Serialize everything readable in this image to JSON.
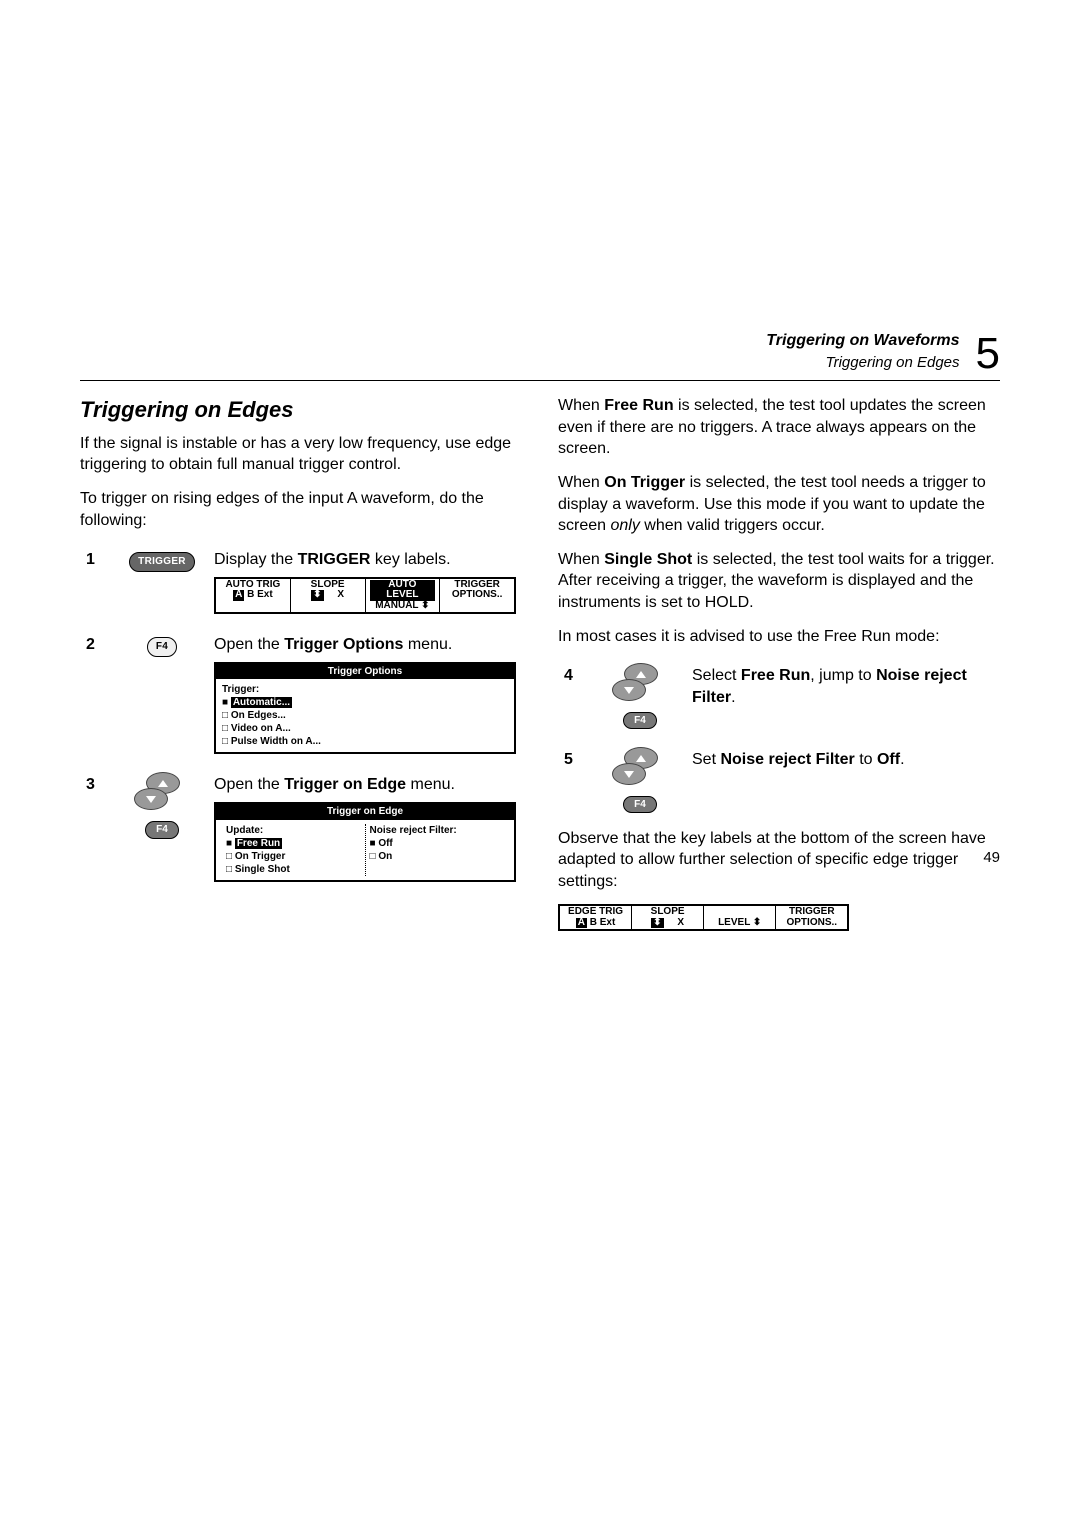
{
  "header": {
    "line1": "Triggering on Waveforms",
    "line2": "Triggering on Edges",
    "chapter": "5"
  },
  "left": {
    "title": "Triggering on Edges",
    "intro1": "If the signal is instable or has a very low frequency, use edge triggering to obtain full manual trigger control.",
    "intro2": "To trigger on rising edges of the input A waveform, do the following:",
    "steps": {
      "s1": {
        "num": "1",
        "btn": "TRIGGER",
        "text_a": "Display the ",
        "text_b": "TRIGGER",
        "text_c": " key labels.",
        "bar": {
          "c1a": "AUTO TRIG",
          "c1b": "A",
          "c1c": "B",
          "c1d": "Ext",
          "c2a": "SLOPE",
          "c3a": "AUTO LEVEL",
          "c3b": "MANUAL",
          "c4a": "TRIGGER",
          "c4b": "OPTIONS.."
        }
      },
      "s2": {
        "num": "2",
        "btn": "F4",
        "text_a": "Open the ",
        "text_b": "Trigger Options",
        "text_c": " menu.",
        "popup": {
          "title": "Trigger Options",
          "label": "Trigger:",
          "opt1": "Automatic...",
          "opt2": "On Edges...",
          "opt3": "Video on A...",
          "opt4": "Pulse Width on A..."
        }
      },
      "s3": {
        "num": "3",
        "btn": "F4",
        "text_a": "Open the ",
        "text_b": "Trigger on Edge",
        "text_c": " menu.",
        "popup": {
          "title": "Trigger on Edge",
          "left_label": "Update:",
          "left_opt1": "Free Run",
          "left_opt2": "On Trigger",
          "left_opt3": "Single Shot",
          "right_label": "Noise reject Filter:",
          "right_opt1": "Off",
          "right_opt2": "On"
        }
      }
    }
  },
  "right": {
    "p1_a": "When ",
    "p1_b": "Free Run",
    "p1_c": " is selected, the test tool updates the screen even if there are no triggers. A trace always appears on the screen.",
    "p2_a": "When ",
    "p2_b": "On Trigger",
    "p2_c": " is selected, the test tool needs a trigger to display a waveform. Use this mode if you want to update the screen ",
    "p2_d": "only",
    "p2_e": " when valid triggers occur.",
    "p3_a": "When ",
    "p3_b": "Single Shot",
    "p3_c": " is selected, the test tool waits for a trigger. After receiving a trigger, the waveform is displayed and the instruments is set to HOLD.",
    "p4": "In most cases it is advised to use the Free Run mode:",
    "steps": {
      "s4": {
        "num": "4",
        "btn": "F4",
        "t1": "Select ",
        "t2": "Free Run",
        "t3": ", jump to ",
        "t4": "Noise reject Filter",
        "t5": "."
      },
      "s5": {
        "num": "5",
        "btn": "F4",
        "t1": "Set ",
        "t2": "Noise reject Filter",
        "t3": " to ",
        "t4": "Off",
        "t5": "."
      }
    },
    "p5": "Observe that the key labels at the bottom of the screen have adapted to allow further selection of specific edge trigger settings:",
    "bar": {
      "c1a": "EDGE TRIG",
      "c1b": "A",
      "c1c": "B",
      "c1d": "Ext",
      "c2a": "SLOPE",
      "c3a": "LEVEL",
      "c4a": "TRIGGER",
      "c4b": "OPTIONS.."
    }
  },
  "pagenum": "49"
}
